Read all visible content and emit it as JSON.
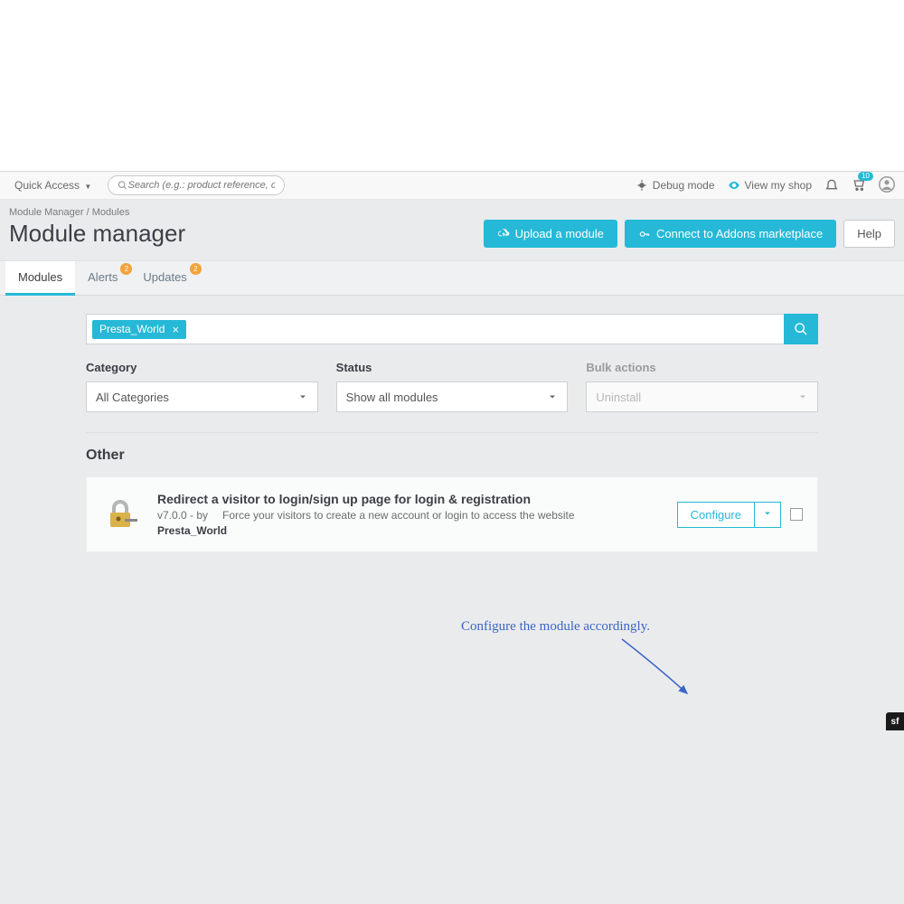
{
  "topbar": {
    "quick_access": "Quick Access",
    "search_placeholder": "Search (e.g.: product reference, custome",
    "debug_mode": "Debug mode",
    "view_shop": "View my shop",
    "notif_badge": "10"
  },
  "breadcrumb": {
    "a": "Module Manager",
    "b": "Modules"
  },
  "page_title": "Module manager",
  "actions": {
    "upload": "Upload a module",
    "addons": "Connect to Addons marketplace",
    "help": "Help"
  },
  "tabs": {
    "modules": "Modules",
    "alerts": "Alerts",
    "alerts_count": "2",
    "updates": "Updates",
    "updates_count": "2"
  },
  "search_chip": "Presta_World",
  "filters": {
    "category_label": "Category",
    "category_value": "All Categories",
    "status_label": "Status",
    "status_value": "Show all modules",
    "bulk_label": "Bulk actions",
    "bulk_value": "Uninstall"
  },
  "section": "Other",
  "module": {
    "title": "Redirect a visitor to login/sign up page for login & registration",
    "version_by": "v7.0.0 - by",
    "desc": "Force your visitors to create a new account or login to access the website",
    "author": "Presta_World",
    "configure": "Configure"
  },
  "annotation": "Configure the module accordingly."
}
